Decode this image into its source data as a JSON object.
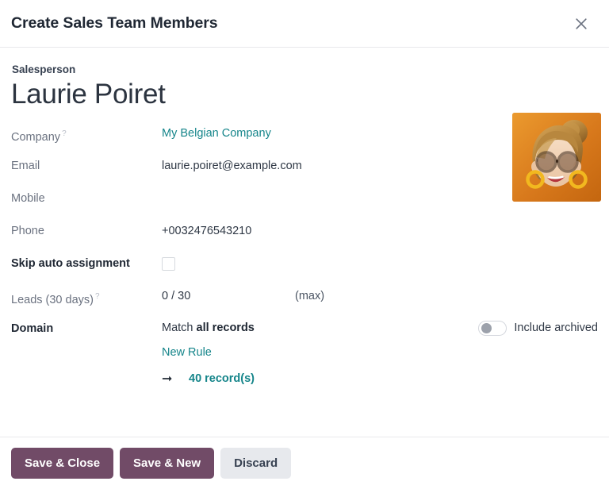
{
  "header": {
    "title": "Create Sales Team Members",
    "close_icon": "close-icon"
  },
  "record": {
    "eyebrow": "Salesperson",
    "name": "Laurie Poiret",
    "avatar_icon": "avatar-woman-with-glasses"
  },
  "fields": {
    "company": {
      "label": "Company",
      "help": "?",
      "value": "My Belgian Company"
    },
    "email": {
      "label": "Email",
      "value": "laurie.poiret@example.com"
    },
    "mobile": {
      "label": "Mobile",
      "value": ""
    },
    "phone": {
      "label": "Phone",
      "value": "+0032476543210"
    },
    "skip_auto_assignment": {
      "label": "Skip auto assignment",
      "checked": false
    },
    "leads": {
      "label": "Leads (30 days)",
      "help": "?",
      "value": "0 / 30",
      "suffix": "(max)"
    },
    "domain": {
      "label": "Domain",
      "match_prefix": "Match",
      "match_target": "all records",
      "new_rule": "New Rule",
      "arrow_icon": "arrow-right-icon",
      "record_count": "40 record(s)",
      "include_archived_label": "Include archived",
      "include_archived_on": false
    }
  },
  "footer": {
    "save_close": "Save & Close",
    "save_new": "Save & New",
    "discard": "Discard"
  },
  "colors": {
    "accent_teal": "#15858a",
    "primary_purple": "#714b67",
    "title_dark": "#1f2733",
    "label_gray": "#6b7280"
  }
}
